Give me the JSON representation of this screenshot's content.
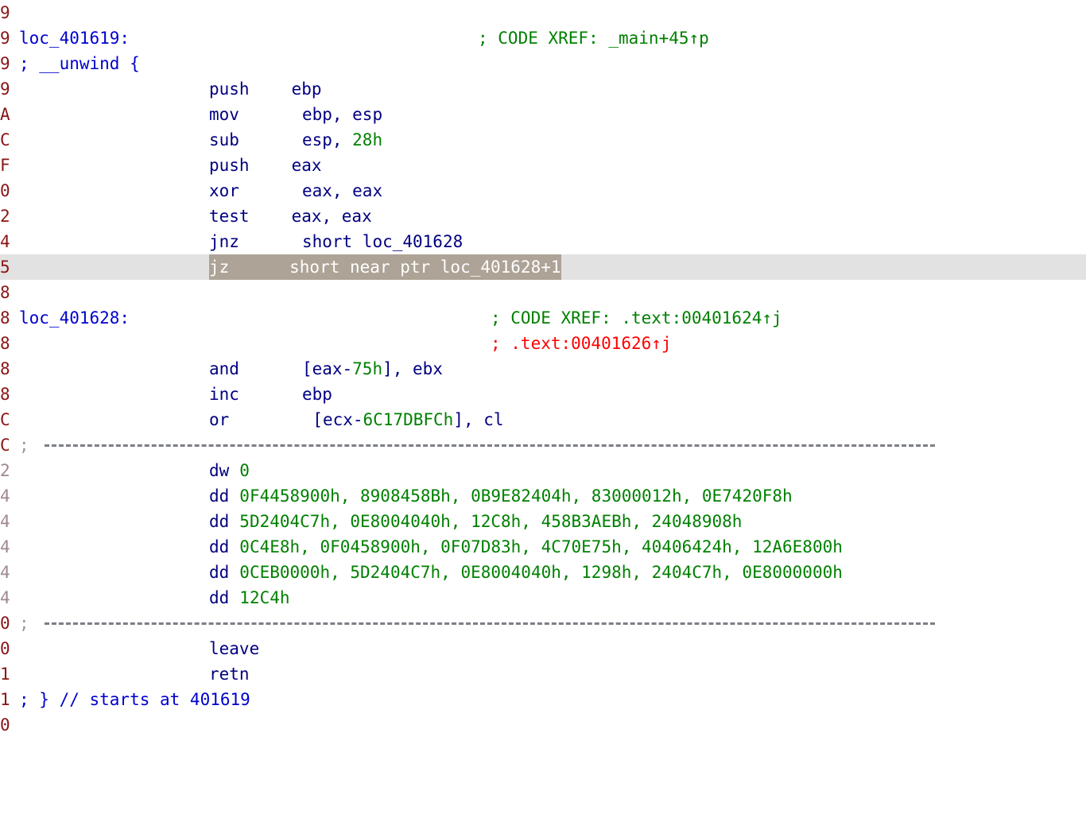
{
  "view": {
    "title": "IDA View-A",
    "segment": ".text",
    "colors": {
      "background": "#ffffff",
      "address": "#8b1414",
      "address_dim": "#a08890",
      "label": "#0000cd",
      "comment": "#0000cd",
      "mnemonic": "#000080",
      "number": "#008000",
      "xref_code": "#008000",
      "xref_alt": "#ff0000",
      "separator": "#7b7f86",
      "current_line_bg": "#e2e2e2",
      "selection_bg": "#ada396",
      "selection_fg": "#ffffff"
    }
  },
  "lines": [
    {
      "address_tail": "9",
      "addr_dim": false,
      "kind": "blank",
      "text": ""
    },
    {
      "address_tail": "9",
      "addr_dim": false,
      "kind": "label",
      "label": "loc_401619:",
      "xref": "; CODE XREF: _main+45↑p",
      "xref_color": "green"
    },
    {
      "address_tail": "9",
      "addr_dim": false,
      "kind": "comment",
      "comment": "; __unwind {"
    },
    {
      "address_tail": "9",
      "addr_dim": false,
      "kind": "insn",
      "mnemonic": "push",
      "operands_plain": "ebp"
    },
    {
      "address_tail": "A",
      "addr_dim": false,
      "kind": "insn",
      "mnemonic": "mov",
      "operands_plain": "ebp, esp"
    },
    {
      "address_tail": "C",
      "addr_dim": false,
      "kind": "insn",
      "mnemonic": "sub",
      "operand_pre": "esp, ",
      "operand_num": "28h",
      "operand_post": ""
    },
    {
      "address_tail": "F",
      "addr_dim": false,
      "kind": "insn",
      "mnemonic": "push",
      "operands_plain": "eax"
    },
    {
      "address_tail": "0",
      "addr_dim": false,
      "kind": "insn",
      "mnemonic": "xor",
      "operands_plain": "eax, eax"
    },
    {
      "address_tail": "2",
      "addr_dim": false,
      "kind": "insn",
      "mnemonic": "test",
      "operands_plain": "eax, eax"
    },
    {
      "address_tail": "4",
      "addr_dim": false,
      "kind": "insn",
      "mnemonic": "jnz",
      "operands_plain": "short loc_401628"
    },
    {
      "address_tail": "5",
      "addr_dim": false,
      "kind": "current",
      "selected_text": "jz      short near ptr loc_401628+1"
    },
    {
      "address_tail": "8",
      "addr_dim": false,
      "kind": "blank",
      "text": ""
    },
    {
      "address_tail": "8",
      "addr_dim": false,
      "kind": "label",
      "label": "loc_401628:",
      "xref": "; CODE XREF: .text:00401624↑j",
      "xref_color": "green"
    },
    {
      "address_tail": "8",
      "addr_dim": false,
      "kind": "xrefonly",
      "xref": "; .text:00401626↑j",
      "xref_color": "red"
    },
    {
      "address_tail": "8",
      "addr_dim": false,
      "kind": "insn",
      "mnemonic": "and",
      "operand_pre": "[eax-",
      "operand_num": "75h",
      "operand_post": "], ebx"
    },
    {
      "address_tail": "8",
      "addr_dim": false,
      "kind": "insn",
      "mnemonic": "inc",
      "operands_plain": "ebp"
    },
    {
      "address_tail": "C",
      "addr_dim": false,
      "kind": "insn",
      "mnemonic": "or",
      "operand_pre": "[ecx-",
      "operand_num": "6C17DBFCh",
      "operand_post": "], cl"
    },
    {
      "address_tail": "C",
      "addr_dim": false,
      "kind": "separator",
      "text": ";"
    },
    {
      "address_tail": "2",
      "addr_dim": true,
      "kind": "data",
      "mnemonic": "dw",
      "values": "0"
    },
    {
      "address_tail": "4",
      "addr_dim": true,
      "kind": "data",
      "mnemonic": "dd",
      "values": "0F4458900h, 8908458Bh, 0B9E82404h, 83000012h, 0E7420F8h"
    },
    {
      "address_tail": "4",
      "addr_dim": true,
      "kind": "data",
      "mnemonic": "dd",
      "values": "5D2404C7h, 0E8004040h, 12C8h, 458B3AEBh, 24048908h"
    },
    {
      "address_tail": "4",
      "addr_dim": true,
      "kind": "data",
      "mnemonic": "dd",
      "values": "0C4E8h, 0F0458900h, 0F07D83h, 4C70E75h, 40406424h, 12A6E800h"
    },
    {
      "address_tail": "4",
      "addr_dim": true,
      "kind": "data",
      "mnemonic": "dd",
      "values": "0CEB0000h, 5D2404C7h, 0E8004040h, 1298h, 2404C7h, 0E8000000h"
    },
    {
      "address_tail": "4",
      "addr_dim": true,
      "kind": "data",
      "mnemonic": "dd",
      "values": "12C4h"
    },
    {
      "address_tail": "0",
      "addr_dim": false,
      "kind": "separator",
      "text": ";"
    },
    {
      "address_tail": "0",
      "addr_dim": false,
      "kind": "insn",
      "mnemonic": "leave",
      "operands_plain": ""
    },
    {
      "address_tail": "1",
      "addr_dim": false,
      "kind": "insn",
      "mnemonic": "retn",
      "operands_plain": ""
    },
    {
      "address_tail": "1",
      "addr_dim": false,
      "kind": "comment",
      "comment": "; } // starts at 401619"
    },
    {
      "address_tail": "0",
      "addr_dim": false,
      "kind": "blank",
      "text": ""
    }
  ]
}
